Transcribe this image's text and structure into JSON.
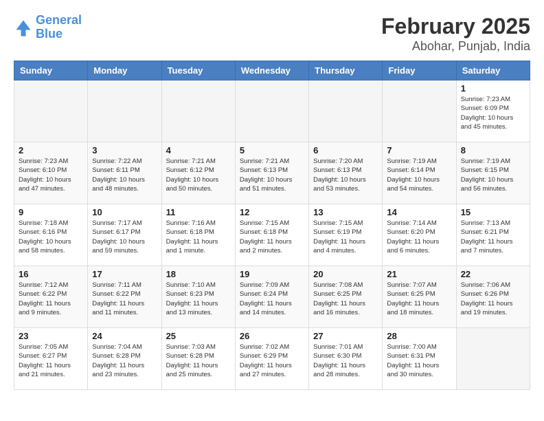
{
  "header": {
    "logo_line1": "General",
    "logo_line2": "Blue",
    "title": "February 2025",
    "subtitle": "Abohar, Punjab, India"
  },
  "days_of_week": [
    "Sunday",
    "Monday",
    "Tuesday",
    "Wednesday",
    "Thursday",
    "Friday",
    "Saturday"
  ],
  "weeks": [
    {
      "days": [
        {
          "number": "",
          "info": ""
        },
        {
          "number": "",
          "info": ""
        },
        {
          "number": "",
          "info": ""
        },
        {
          "number": "",
          "info": ""
        },
        {
          "number": "",
          "info": ""
        },
        {
          "number": "",
          "info": ""
        },
        {
          "number": "1",
          "info": "Sunrise: 7:23 AM\nSunset: 6:09 PM\nDaylight: 10 hours\nand 45 minutes."
        }
      ]
    },
    {
      "days": [
        {
          "number": "2",
          "info": "Sunrise: 7:23 AM\nSunset: 6:10 PM\nDaylight: 10 hours\nand 47 minutes."
        },
        {
          "number": "3",
          "info": "Sunrise: 7:22 AM\nSunset: 6:11 PM\nDaylight: 10 hours\nand 48 minutes."
        },
        {
          "number": "4",
          "info": "Sunrise: 7:21 AM\nSunset: 6:12 PM\nDaylight: 10 hours\nand 50 minutes."
        },
        {
          "number": "5",
          "info": "Sunrise: 7:21 AM\nSunset: 6:13 PM\nDaylight: 10 hours\nand 51 minutes."
        },
        {
          "number": "6",
          "info": "Sunrise: 7:20 AM\nSunset: 6:13 PM\nDaylight: 10 hours\nand 53 minutes."
        },
        {
          "number": "7",
          "info": "Sunrise: 7:19 AM\nSunset: 6:14 PM\nDaylight: 10 hours\nand 54 minutes."
        },
        {
          "number": "8",
          "info": "Sunrise: 7:19 AM\nSunset: 6:15 PM\nDaylight: 10 hours\nand 56 minutes."
        }
      ]
    },
    {
      "days": [
        {
          "number": "9",
          "info": "Sunrise: 7:18 AM\nSunset: 6:16 PM\nDaylight: 10 hours\nand 58 minutes."
        },
        {
          "number": "10",
          "info": "Sunrise: 7:17 AM\nSunset: 6:17 PM\nDaylight: 10 hours\nand 59 minutes."
        },
        {
          "number": "11",
          "info": "Sunrise: 7:16 AM\nSunset: 6:18 PM\nDaylight: 11 hours\nand 1 minute."
        },
        {
          "number": "12",
          "info": "Sunrise: 7:15 AM\nSunset: 6:18 PM\nDaylight: 11 hours\nand 2 minutes."
        },
        {
          "number": "13",
          "info": "Sunrise: 7:15 AM\nSunset: 6:19 PM\nDaylight: 11 hours\nand 4 minutes."
        },
        {
          "number": "14",
          "info": "Sunrise: 7:14 AM\nSunset: 6:20 PM\nDaylight: 11 hours\nand 6 minutes."
        },
        {
          "number": "15",
          "info": "Sunrise: 7:13 AM\nSunset: 6:21 PM\nDaylight: 11 hours\nand 7 minutes."
        }
      ]
    },
    {
      "days": [
        {
          "number": "16",
          "info": "Sunrise: 7:12 AM\nSunset: 6:22 PM\nDaylight: 11 hours\nand 9 minutes."
        },
        {
          "number": "17",
          "info": "Sunrise: 7:11 AM\nSunset: 6:22 PM\nDaylight: 11 hours\nand 11 minutes."
        },
        {
          "number": "18",
          "info": "Sunrise: 7:10 AM\nSunset: 6:23 PM\nDaylight: 11 hours\nand 13 minutes."
        },
        {
          "number": "19",
          "info": "Sunrise: 7:09 AM\nSunset: 6:24 PM\nDaylight: 11 hours\nand 14 minutes."
        },
        {
          "number": "20",
          "info": "Sunrise: 7:08 AM\nSunset: 6:25 PM\nDaylight: 11 hours\nand 16 minutes."
        },
        {
          "number": "21",
          "info": "Sunrise: 7:07 AM\nSunset: 6:25 PM\nDaylight: 11 hours\nand 18 minutes."
        },
        {
          "number": "22",
          "info": "Sunrise: 7:06 AM\nSunset: 6:26 PM\nDaylight: 11 hours\nand 19 minutes."
        }
      ]
    },
    {
      "days": [
        {
          "number": "23",
          "info": "Sunrise: 7:05 AM\nSunset: 6:27 PM\nDaylight: 11 hours\nand 21 minutes."
        },
        {
          "number": "24",
          "info": "Sunrise: 7:04 AM\nSunset: 6:28 PM\nDaylight: 11 hours\nand 23 minutes."
        },
        {
          "number": "25",
          "info": "Sunrise: 7:03 AM\nSunset: 6:28 PM\nDaylight: 11 hours\nand 25 minutes."
        },
        {
          "number": "26",
          "info": "Sunrise: 7:02 AM\nSunset: 6:29 PM\nDaylight: 11 hours\nand 27 minutes."
        },
        {
          "number": "27",
          "info": "Sunrise: 7:01 AM\nSunset: 6:30 PM\nDaylight: 11 hours\nand 28 minutes."
        },
        {
          "number": "28",
          "info": "Sunrise: 7:00 AM\nSunset: 6:31 PM\nDaylight: 11 hours\nand 30 minutes."
        },
        {
          "number": "",
          "info": ""
        }
      ]
    }
  ]
}
